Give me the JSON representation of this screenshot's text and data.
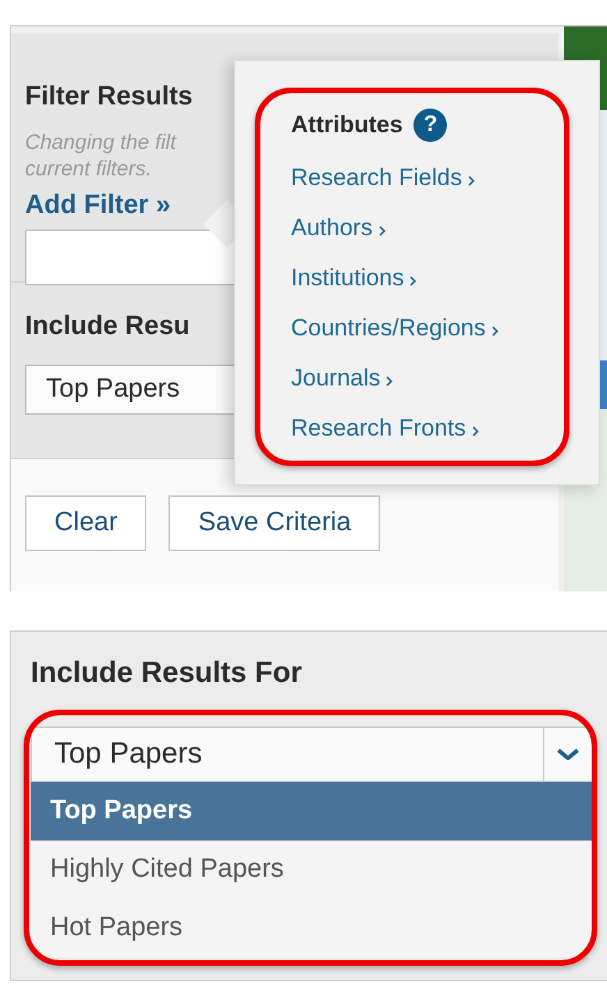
{
  "filter_panel": {
    "title": "Filter Results",
    "hint_lines": [
      "Changing the filt",
      "current filters."
    ],
    "add_filter_link": "Add Filter »",
    "include_label": "Include Resu",
    "select_value": "Top Papers",
    "buttons": [
      "Clear",
      "Save Criteria"
    ]
  },
  "attributes_popup": {
    "title": "Attributes",
    "help_icon": "?",
    "items": [
      {
        "label": "Research Fields"
      },
      {
        "label": "Authors"
      },
      {
        "label": "Institutions"
      },
      {
        "label": "Countries/Regions"
      },
      {
        "label": "Journals"
      },
      {
        "label": "Research Fronts"
      }
    ]
  },
  "include_results": {
    "label": "Include Results For",
    "select_value": "Top Papers",
    "options": [
      {
        "label": "Top Papers",
        "selected": true
      },
      {
        "label": "Highly Cited Papers",
        "selected": false
      },
      {
        "label": "Hot Papers",
        "selected": false
      }
    ]
  }
}
